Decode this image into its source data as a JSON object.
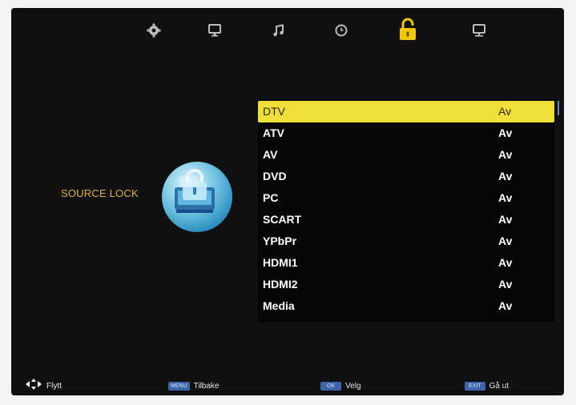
{
  "top_icons": [
    {
      "name": "gear-icon",
      "active": false
    },
    {
      "name": "monitor-icon",
      "active": false
    },
    {
      "name": "music-note-icon",
      "active": false
    },
    {
      "name": "clock-icon",
      "active": false
    },
    {
      "name": "padlock-icon",
      "active": true
    },
    {
      "name": "display-icon",
      "active": false
    }
  ],
  "colors": {
    "accent": "#f2c600",
    "selected_row": "#f0de3a",
    "label": "#e0b23c",
    "key": "#3d63a8"
  },
  "section": {
    "title": "SOURCE LOCK"
  },
  "sources": [
    {
      "name": "DTV",
      "value": "Av",
      "selected": true
    },
    {
      "name": "ATV",
      "value": "Av"
    },
    {
      "name": "AV",
      "value": "Av"
    },
    {
      "name": "DVD",
      "value": "Av"
    },
    {
      "name": "PC",
      "value": "Av"
    },
    {
      "name": "SCART",
      "value": "Av"
    },
    {
      "name": "YPbPr",
      "value": "Av"
    },
    {
      "name": "HDMI1",
      "value": "Av"
    },
    {
      "name": "HDMI2",
      "value": "Av"
    },
    {
      "name": "Media",
      "value": "Av"
    }
  ],
  "footer": {
    "move": {
      "icon": "dpad-arrows-icon",
      "label": "Flytt"
    },
    "back": {
      "key": "MENU",
      "label": "Tilbake"
    },
    "select": {
      "key": "OK",
      "label": "Velg"
    },
    "exit": {
      "key": "EXIT",
      "label": "Gå ut"
    }
  }
}
